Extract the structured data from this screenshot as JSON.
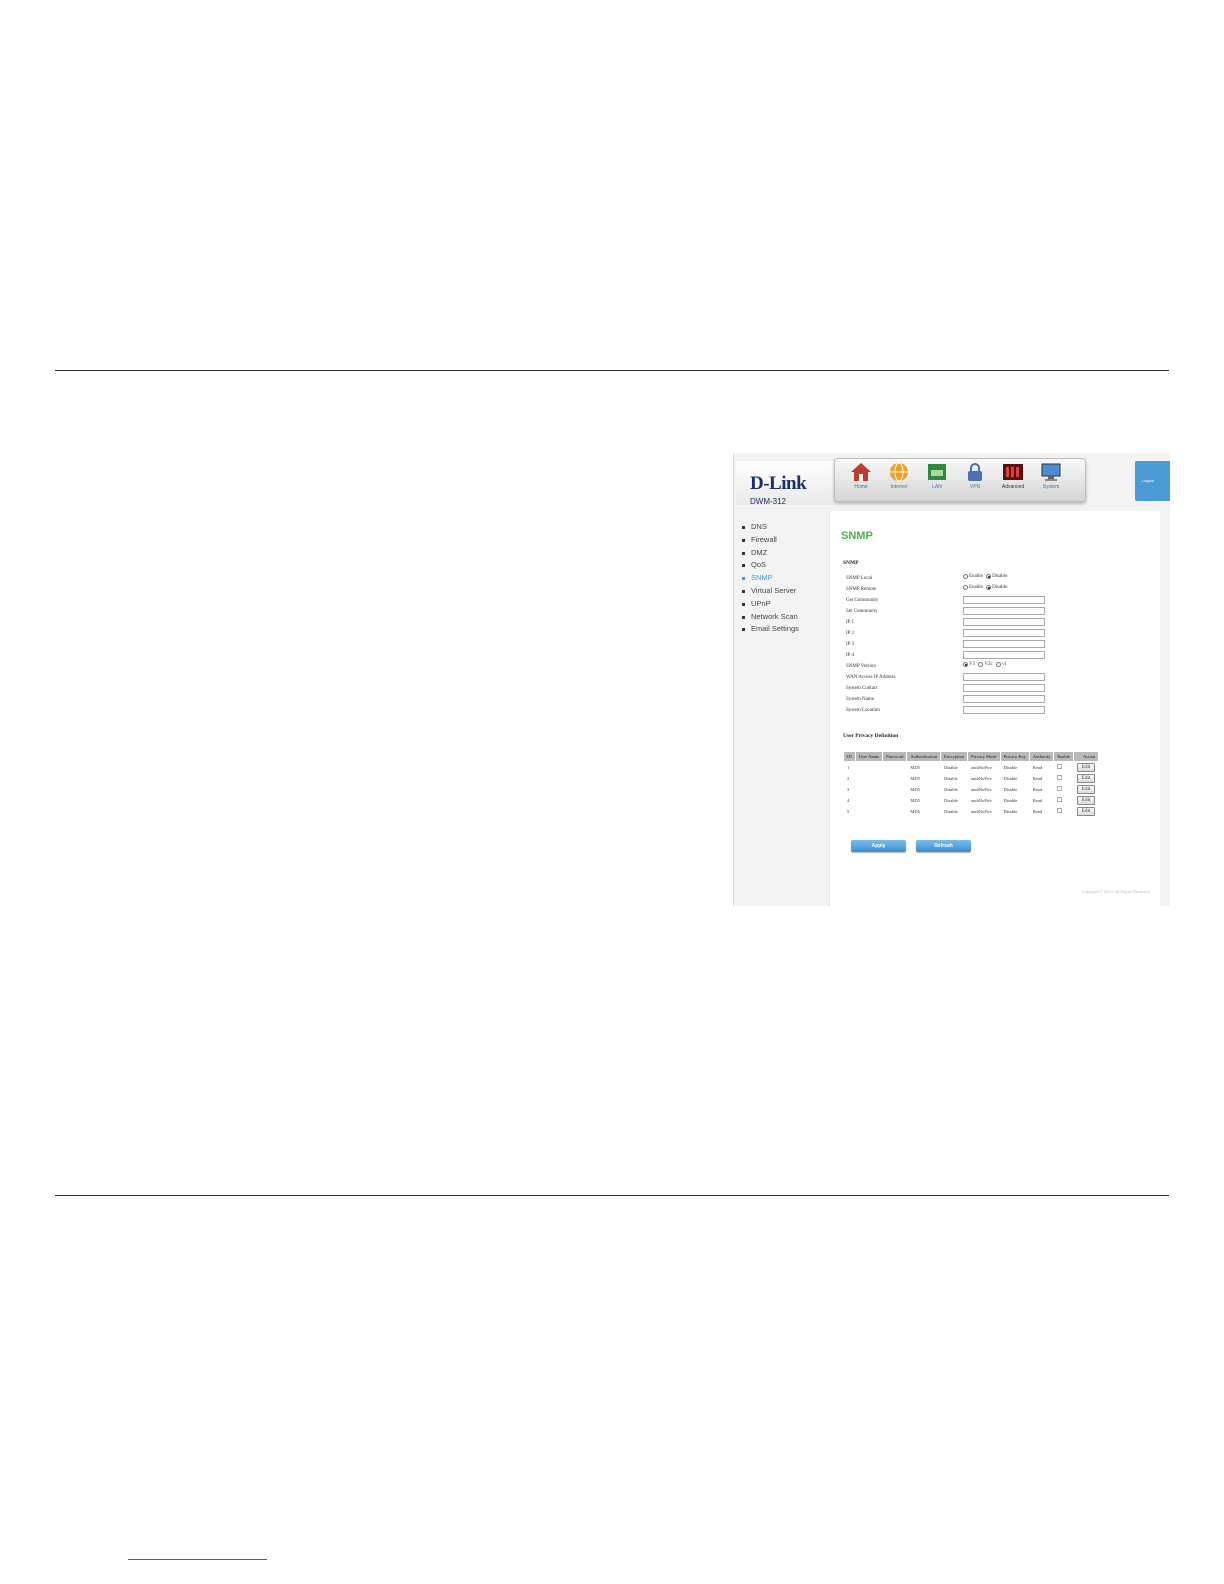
{
  "brand": {
    "logo": "D-Link",
    "model": "DWM-312"
  },
  "nav": [
    {
      "label": "Home",
      "icon": "home-icon",
      "color": "#c0392b"
    },
    {
      "label": "Internet",
      "icon": "globe-icon",
      "color": "#f0a020"
    },
    {
      "label": "LAN",
      "icon": "lan-icon",
      "color": "#2e8b3e"
    },
    {
      "label": "VPN",
      "icon": "lock-icon",
      "color": "#4a6fb5"
    },
    {
      "label": "Advanced",
      "icon": "advanced-icon",
      "color": "#8b1a1a"
    },
    {
      "label": "System",
      "icon": "monitor-icon",
      "color": "#4a8fd6"
    }
  ],
  "logout": "Logout",
  "sidebar": [
    "DNS",
    "Firewall",
    "DMZ",
    "QoS",
    "SNMP",
    "Virtual Server",
    "UPnP",
    "Network Scan",
    "Email Settings"
  ],
  "page_title": "SNMP",
  "form": {
    "section": "SNMP",
    "snmp_local": {
      "label": "SNMP Local",
      "opt1": "Enable",
      "opt2": "Disable"
    },
    "snmp_remote": {
      "label": "SNMP Remote",
      "opt1": "Enable",
      "opt2": "Disable"
    },
    "get_community": "Get Community",
    "set_community": "Set Community",
    "ip1": "IP 1",
    "ip2": "IP 2",
    "ip3": "IP 3",
    "ip4": "IP 4",
    "snmp_version": {
      "label": "SNMP Version",
      "opt1": "V3",
      "opt2": "V2c",
      "opt3": "v1"
    },
    "wan_access": "WAN Access IP Address",
    "system_contact": "System Contact",
    "system_name": "System Name",
    "system_location": "System Location"
  },
  "upd": {
    "title": "User Privacy Definition",
    "headers": [
      "ID",
      "User Name",
      "Password",
      "Authentication",
      "Encryption",
      "Privacy Mode",
      "Privacy Key",
      "Authority",
      "Enable",
      "Action"
    ],
    "rows": [
      {
        "id": "1",
        "auth": "MD5",
        "enc": "Disable",
        "mode": "authNoPriv",
        "key": "Disable",
        "authority": "Read",
        "action": "Edit"
      },
      {
        "id": "2",
        "auth": "MD5",
        "enc": "Disable",
        "mode": "authNoPriv",
        "key": "Disable",
        "authority": "Read",
        "action": "Edit"
      },
      {
        "id": "3",
        "auth": "MD5",
        "enc": "Disable",
        "mode": "authNoPriv",
        "key": "Disable",
        "authority": "Read",
        "action": "Edit"
      },
      {
        "id": "4",
        "auth": "MD5",
        "enc": "Disable",
        "mode": "authNoPriv",
        "key": "Disable",
        "authority": "Read",
        "action": "Edit"
      },
      {
        "id": "5",
        "auth": "MD5",
        "enc": "Disable",
        "mode": "authNoPriv",
        "key": "Disable",
        "authority": "Read",
        "action": "Edit"
      }
    ]
  },
  "buttons": {
    "apply": "Apply",
    "refresh": "Refresh"
  },
  "copyright": "Copyright © 2013. All Rights Reserved"
}
